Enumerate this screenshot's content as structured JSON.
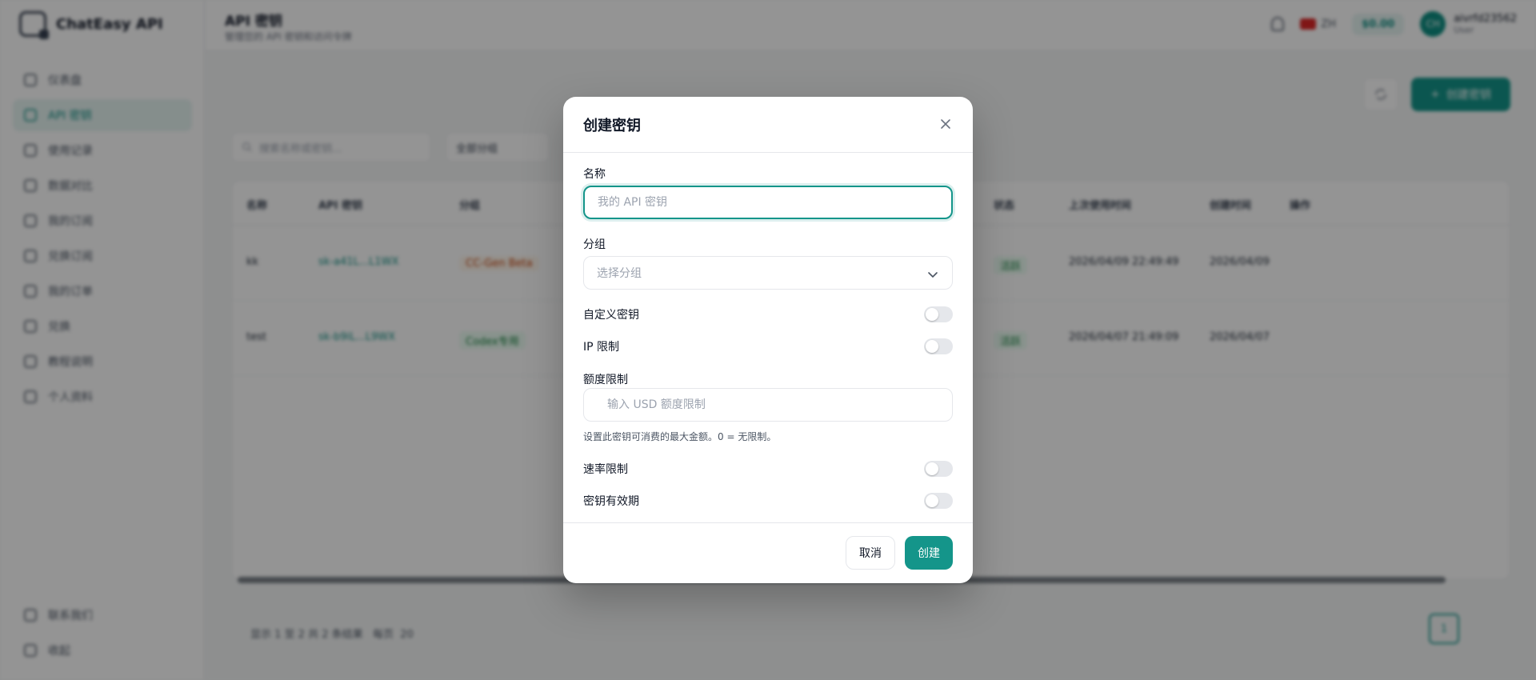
{
  "app": {
    "name": "ChatEasy API"
  },
  "sidebar": {
    "items": [
      {
        "label": "仪表盘",
        "icon": "dashboard-icon"
      },
      {
        "label": "API 密钥",
        "icon": "key-icon",
        "active": true
      },
      {
        "label": "使用记录",
        "icon": "chart-icon"
      },
      {
        "label": "数据对比",
        "icon": "compare-icon"
      },
      {
        "label": "我的订阅",
        "icon": "subscription-icon"
      },
      {
        "label": "兑换订阅",
        "icon": "redeem-icon"
      },
      {
        "label": "我的订单",
        "icon": "orders-icon"
      },
      {
        "label": "兑换",
        "icon": "gift-icon"
      },
      {
        "label": "教程说明",
        "icon": "doc-icon"
      },
      {
        "label": "个人资料",
        "icon": "user-icon"
      }
    ],
    "bottom": [
      {
        "label": "联系我们",
        "icon": "phone-icon"
      },
      {
        "label": "收起",
        "icon": "collapse-icon"
      }
    ]
  },
  "topbar": {
    "title": "API 密钥",
    "subtitle": "管理您的 API 密钥和访问令牌",
    "language": "ZH",
    "balance": "$0.00",
    "avatar_initials": "CH",
    "user_name": "aivrfd23562",
    "user_role": "User"
  },
  "main": {
    "create_button": "创建密钥",
    "search_placeholder": "搜索名称或密钥...",
    "filter_value": "全部分组",
    "table": {
      "headers": [
        "名称",
        "API 密钥",
        "分组",
        "状态",
        "上次使用时间",
        "创建时间",
        "操作"
      ],
      "rows": [
        {
          "name": "kk",
          "key": "sk-a41L...L1WX",
          "group": "CC-Gen Beta",
          "status": "活跃",
          "last_used": "2026/04/09 22:49:49",
          "created": "2026/04/09"
        },
        {
          "name": "test",
          "key": "sk-b9iL...L9WX",
          "group": "Codex专用",
          "status": "活跃",
          "last_used": "2026/04/07 21:49:09",
          "created": "2026/04/07"
        }
      ]
    },
    "footer_text": "显示 1 至 2 共 2 条结果",
    "per_page_label": "每页",
    "per_page_value": "20",
    "current_page": "1"
  },
  "modal": {
    "title": "创建密钥",
    "name_label": "名称",
    "name_placeholder": "我的 API 密钥",
    "name_value": "",
    "group_label": "分组",
    "group_placeholder": "选择分组",
    "custom_key_label": "自定义密钥",
    "ip_limit_label": "IP 限制",
    "quota_label": "额度限制",
    "quota_currency": "$",
    "quota_placeholder": "输入 USD 额度限制",
    "quota_help": "设置此密钥可消费的最大金额。0 = 无限制。",
    "rate_limit_label": "速率限制",
    "expiry_label": "密钥有效期",
    "cancel_label": "取消",
    "create_label": "创建"
  },
  "colors": {
    "accent": "#14958a",
    "overlay": "rgba(0,0,0,0.42)"
  }
}
